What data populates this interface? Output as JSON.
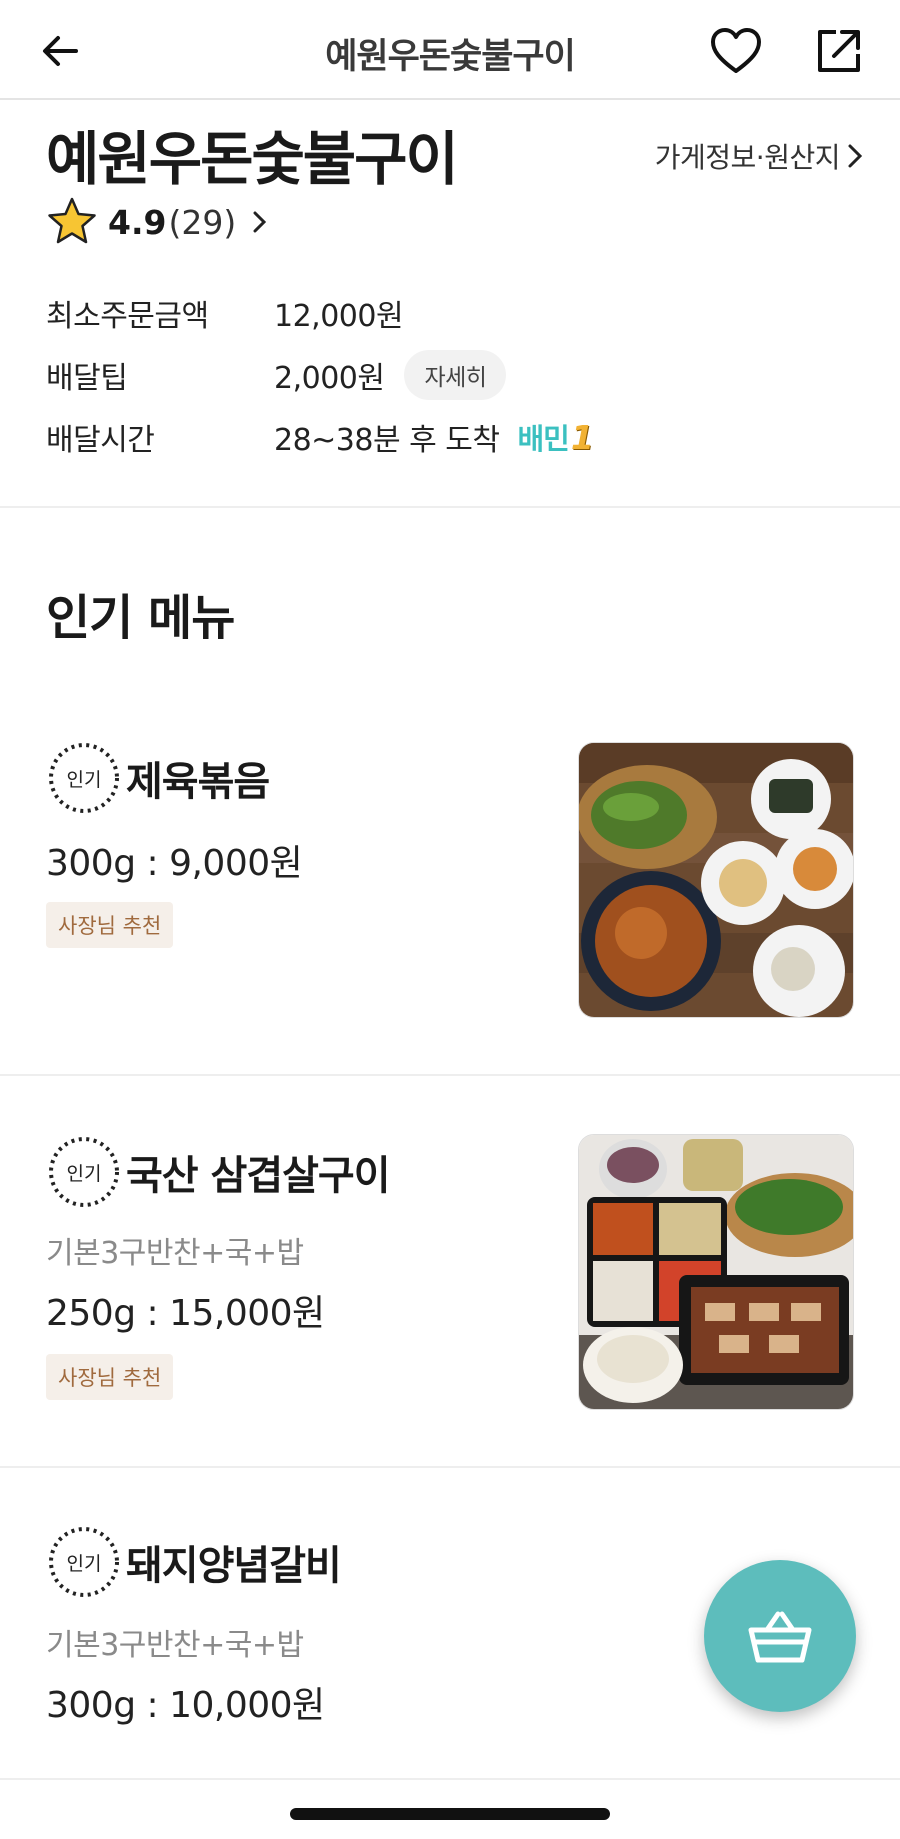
{
  "header": {
    "title": "예원우돈숯불구이",
    "back_icon": "back-arrow-icon",
    "favorite_icon": "heart-icon",
    "share_icon": "share-icon"
  },
  "store": {
    "name": "예원우돈숯불구이",
    "info_link": "가게정보·원산지",
    "rating": "4.9",
    "review_count": "(29)"
  },
  "info": {
    "min_order_label": "최소주문금액",
    "min_order_value": "12,000원",
    "delivery_tip_label": "배달팁",
    "delivery_tip_value": "2,000원",
    "detail_button": "자세히",
    "delivery_time_label": "배달시간",
    "delivery_time_value": "28~38분 후 도착",
    "baemin_badge": "배민",
    "baemin_number": "1"
  },
  "popular": {
    "section_title": "인기 메뉴",
    "badge_text": "인기",
    "items": [
      {
        "name": "제육볶음",
        "description": "",
        "price": "300g : 9,000원",
        "tag": "사장님 추천"
      },
      {
        "name": "국산 삼겹살구이",
        "description": "기본3구반찬+국+밥",
        "price": "250g : 15,000원",
        "tag": "사장님 추천"
      },
      {
        "name": "돼지양념갈비",
        "description": "기본3구반찬+국+밥",
        "price": "300g : 10,000원",
        "tag": ""
      }
    ]
  },
  "cart": {
    "icon": "basket-icon"
  },
  "colors": {
    "accent": "#5dbdbc",
    "baemin_teal": "#3bc0c0",
    "tag_bg": "#f5efe9",
    "tag_text": "#a06a3e"
  }
}
